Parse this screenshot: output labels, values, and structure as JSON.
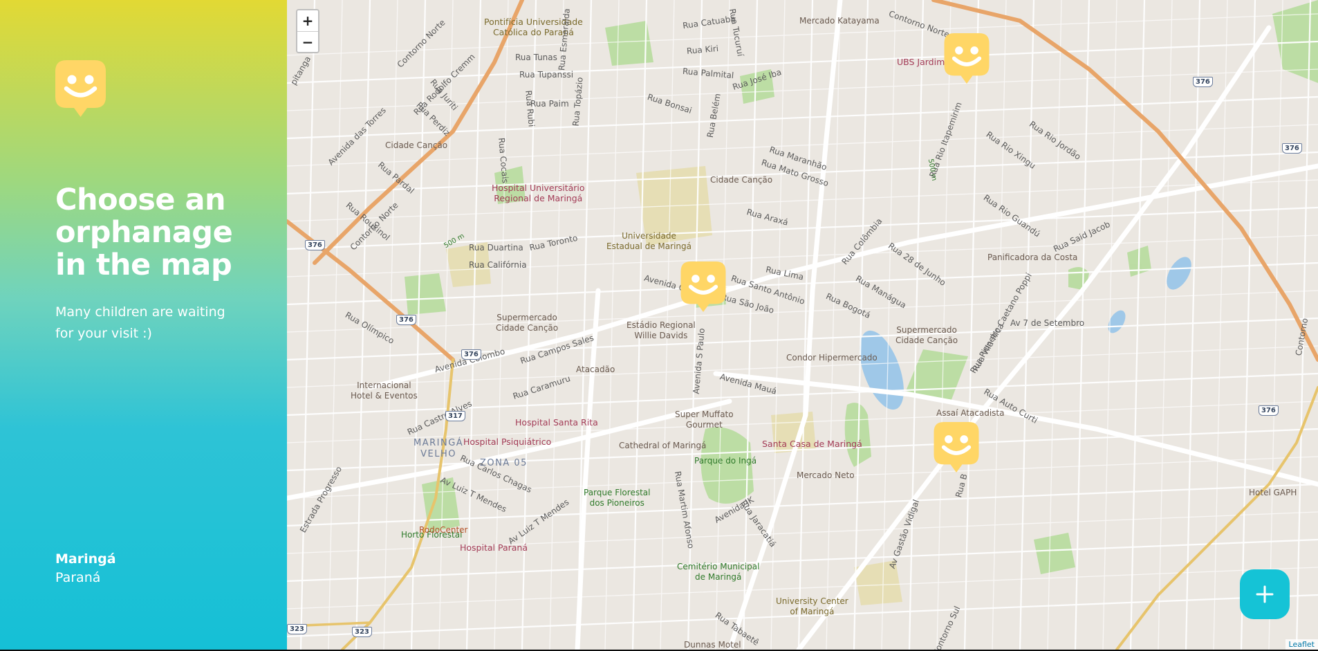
{
  "sidebar": {
    "title": "Choose an\norphanage\nin the map",
    "subtitle": "Many children are waiting\nfor your visit :)",
    "city": "Maringá",
    "state": "Paraná",
    "gradient_colors": [
      "#e2d934",
      "#15c0d6"
    ]
  },
  "map": {
    "zoom_in": "+",
    "zoom_out": "−",
    "attribution": "Leaflet",
    "marker_color": "#ffd666",
    "add_button_color": "#15c3d6",
    "markers": [
      {
        "name": "orphanage-marker-1"
      },
      {
        "name": "orphanage-marker-2"
      },
      {
        "name": "orphanage-marker-3"
      }
    ],
    "labels": {
      "pontificia": "Pontifícia Universidade\nCatólica do Paraná",
      "mercado_katayama": "Mercado Katayama",
      "ubs": "UBS Jardim Alvorada",
      "hospital_univ": "Hospital Universitário\nRegional de Maringá",
      "universidade_estadual": "Universidade\nEstadual de Maringá",
      "cidade_cancao_1": "Cidade Canção",
      "cidade_cancao_2": "Cidade Canção",
      "supermercado_cc_1": "Supermercado\nCidade Canção",
      "supermercado_cc_2": "Supermercado\nCidade Canção",
      "estadio": "Estádio Regional\nWillie Davids",
      "atacadao": "Atacadão",
      "condor": "Condor Hipermercado",
      "panificadora": "Panificadora da Costa",
      "internacional": "Internacional\nHotel & Eventos",
      "hospital_santa_rita": "Hospital Santa Rita",
      "hospital_psiquiatrico": "Hospital Psiquiátrico",
      "maringa_velho": "MARINGÁ\nVELHO",
      "zona_05": "ZONA 05",
      "cathedral": "Cathedral of Maringá",
      "super_muffato": "Super Muffato\nGourmet",
      "parque_inga": "Parque do Ingá",
      "santa_casa": "Santa Casa de Maringá",
      "mercado_neto": "Mercado Neto",
      "assai": "Assaí Atacadista",
      "hotel_gaph": "Hotel GAPH",
      "parque_florestal": "Parque Florestal\ndos Pioneiros",
      "horto": "Horto Florestal",
      "hospital_parana": "Hospital Paraná",
      "rodocenter": "RodoCenter",
      "cemiterio": "Cemitério Municipal\nde Maringá",
      "university_center": "University Center\nof Maringá",
      "dunnas": "Dunnas Motel",
      "rua_catuaba": "Rua Catuaba",
      "rua_kiri": "Rua Kiri",
      "rua_palmital": "Rua Palmital",
      "rua_tunas": "Rua Tunas",
      "rua_tupanssi": "Rua Tupanssi",
      "rua_paim": "Rua Paim",
      "rua_duartina": "Rua Duartina",
      "rua_california": "Rua Califórnia",
      "rua_toronto": "Rua Toronto",
      "avenida_colombo_1": "Avenida Colombo",
      "avenida_colombo_2": "Avenida Colombo",
      "avenida_maua": "Avenida Mauá",
      "avenida_jk": "Avenida JK",
      "contorno_norte_1": "Contorno Norte",
      "contorno_norte_2": "Contorno Norte",
      "contorno_norte_3": "Contorno Norte",
      "av_7_setembro": "Av 7 de Setembro",
      "rua_campos_sales": "Rua Campos Sales",
      "rua_caramuru": "Rua Caramuru",
      "rua_castro_alves": "Rua Castro Alves",
      "av_luiz_mendes_1": "Av Luiz T Mendes",
      "av_luiz_mendes_2": "Av Luiz T Mendes",
      "rua_carlos_chagas": "Rua Carlos Chagas",
      "rua_lima": "Rua Lima",
      "rua_araxa": "Rua Araxá",
      "rua_santo_antonio": "Rua Santo Antônio",
      "rua_sao_joao": "Rua São João",
      "rua_bogota": "Rua Bogotá",
      "rua_manágua": "Rua Manágua",
      "rua_maranhao": "Rua Maranhão",
      "rua_mato_grosso": "Rua Mato Grosso",
      "rua_jose_iba": "Rua José Iba",
      "rua_bonsai": "Rua Bonsai",
      "rua_colombia": "Rua Colômbia",
      "rua_rio_xingu": "Rua Rio Xingu",
      "rua_rio_guandu": "Rua Rio Guandú",
      "rua_rio_jordao": "Rua Rio Jordão",
      "rua_28_junho": "Rua 28 de Junho",
      "rua_b": "Rua B",
      "av_gastao_vidigal": "Av Gastão Vidigal",
      "rua_jaracatia": "Rua Jaracatiá",
      "rua_martim_afonso": "Rua Martim Afonso",
      "rua_olimpico": "Rua Olímpico",
      "rua_rouxinol": "Rua Rouxinol",
      "rua_pardal": "Rua Pardal",
      "rua_perdiz": "Rua Perdiz",
      "rua_juriti": "Rua Juriti",
      "rua_rodolfo_cremm": "Rua Rodolfo Cremm",
      "avenida_das_torres": "Avenida das Torres",
      "rua_cocais": "Rua Cocais",
      "rua_rubi": "Rua Rubi",
      "rua_esmeralda": "Rua Esmeralda",
      "rua_topazio": "Rua Topázio",
      "rua_belem": "Rua Belém",
      "rua_tucurui": "Rua Tucuruí",
      "avenida_s_paulo": "Avenida S Paulo",
      "estrada_progresso": "Estrada Progresso",
      "rua_tabaete": "Rua Tabaetê",
      "rua_said_jacob": "Rua Said Jacob",
      "rua_auto_curti": "Rua Auto Curti",
      "rua_pioneiro": "Rua Pioneiro Caetano Poppi",
      "rua_vila_rica": "Rua Vila Rica",
      "rua_rio_itapemirim": "Rua Rio Itapemirim",
      "contorno_sul": "Contorno Sul",
      "contorno_1": "Contorno",
      "pitanga": "pitanga",
      "dist_500_1": "500 m",
      "dist_500_2": "500 m",
      "r376_1": "376",
      "r376_2": "376",
      "r376_3": "376",
      "r376_4": "376",
      "r376_5": "376",
      "r376_6": "376",
      "r317": "317",
      "r323_1": "323",
      "r323_2": "323"
    }
  }
}
